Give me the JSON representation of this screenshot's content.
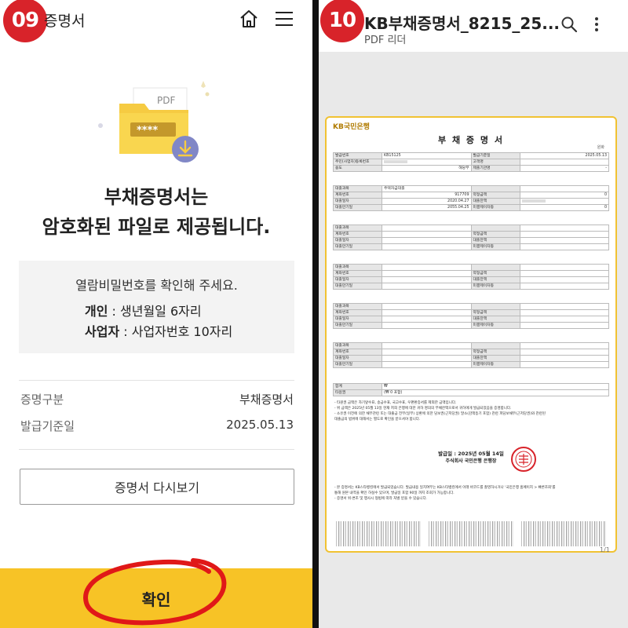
{
  "left": {
    "step": "09",
    "header_title": "증명서",
    "headline_line1": "부채증명서는",
    "headline_line2": "암호화된 파일로 제공됩니다.",
    "illustration": {
      "pdf_label": "PDF",
      "stars": "****"
    },
    "password_box": {
      "prompt": "열람비밀번호를 확인해 주세요.",
      "personal_label": "개인",
      "personal_value": " : 생년월일 6자리",
      "business_label": "사업자",
      "business_value": " : 사업자번호 10자리"
    },
    "info": [
      {
        "label": "증명구분",
        "value": "부채증명서"
      },
      {
        "label": "발급기준일",
        "value": "2025.05.13"
      }
    ],
    "view_button": "증명서 다시보기",
    "confirm_button": "확인"
  },
  "right": {
    "step": "10",
    "title": "KB부채증명서_8215_25...",
    "subtitle": "PDF 리더",
    "page_indicator": "1/1",
    "doc": {
      "logo": "KB국민은행",
      "title": "부 채 증 명 서",
      "unit": "원화",
      "header_rows": [
        [
          "발급번호",
          "KB15125",
          "발급기준일",
          "2025.05.13"
        ],
        [
          "주민(사업자)등록번호",
          "",
          "고객명",
          ""
        ],
        [
          "용도",
          "해당무",
          "제출기관명",
          "-"
        ]
      ],
      "loan1": [
        [
          "대출과목",
          "주택자금대출",
          "",
          ""
        ],
        [
          "계좌번호",
          "917709",
          "약정금액",
          "0"
        ],
        [
          "대출일자",
          "2020.04.27",
          "대출잔액",
          ""
        ],
        [
          "대출만기일",
          "2055.04.25",
          "미결제이자등",
          "0"
        ]
      ],
      "blank_labels": [
        "대출과목",
        "계좌번호",
        "대출일자",
        "대출만기일"
      ],
      "blank_right": [
        "",
        "약정금액",
        "대출잔액",
        "미결제이자등"
      ],
      "total_rows": [
        [
          "합계",
          "₩"
        ],
        [
          "타원권",
          "(₩ 0 포함)"
        ]
      ],
      "notes1": [
        "- 타원권 금액은 자기앞수표, 송금수표, 국고수표, 우편환증서를 제외한 금액입니다.",
        "- 위 금액은 2025년 05월 13일 현재 저희 은행에 대한 귀하 명의의 부채잔액으로서 귀하에게 발급되었음을 증명합니다.",
        "- 소유권 이전에 의한 채무관련 또는 대출금 전부(일부) 상환에 의한 담보권(근저당권) 말소(감액등기 포함) 관련 피담보채무(근저당권)와 관련된",
        "  대출금의 범위에 대해서는 별도로 확인을 받으셔야 합니다."
      ],
      "issue_date": "발급일 : 2025년 05월 14일",
      "issuer": "주식회사 국민은행 은행장",
      "notes2": [
        "- 본 증명서는 KB스타뱅킹에서 발급되었습니다. 발급내용 일치여부는 KB스타뱅킹에서 아래 바코드를 촬영하시거나 '국민은행 홈페이지 > 빠른조회'를",
        "  통해 원본 내역을 확인 하실수 있으며, 발급일 포함 90일 까지 조회가 가능합니다.",
        "- 증명서 위·변조 및 행사시 형법에 따라 처벌 받을 수 있습니다."
      ]
    }
  },
  "colors": {
    "accent_yellow": "#f7c326",
    "badge_red": "#d8232a",
    "annot_red": "#e01818"
  }
}
